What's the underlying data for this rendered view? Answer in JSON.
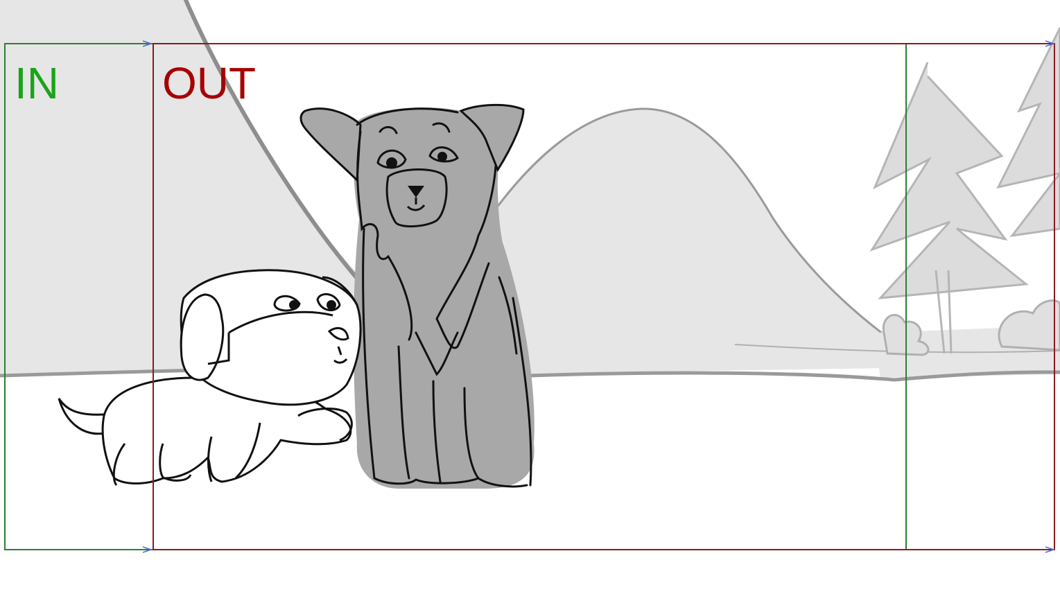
{
  "frames": {
    "in": {
      "label": "IN",
      "color": "#2e7d32",
      "label_color": "#1aa31a"
    },
    "out": {
      "label": "OUT",
      "color": "#8b1a1a",
      "label_color": "#a80000"
    }
  },
  "palette": {
    "background": "#ffffff",
    "hill_fill": "#e6e6e6",
    "hill_line": "#9a9a9a",
    "dog_fill": "#a8a8a8",
    "ink": "#111111",
    "arrow": "#4a6fd6"
  },
  "scene": {
    "characters": [
      "puppy",
      "sitting-dog"
    ],
    "background": [
      "left-slope",
      "center-hill",
      "pine-trees",
      "bushes"
    ]
  }
}
